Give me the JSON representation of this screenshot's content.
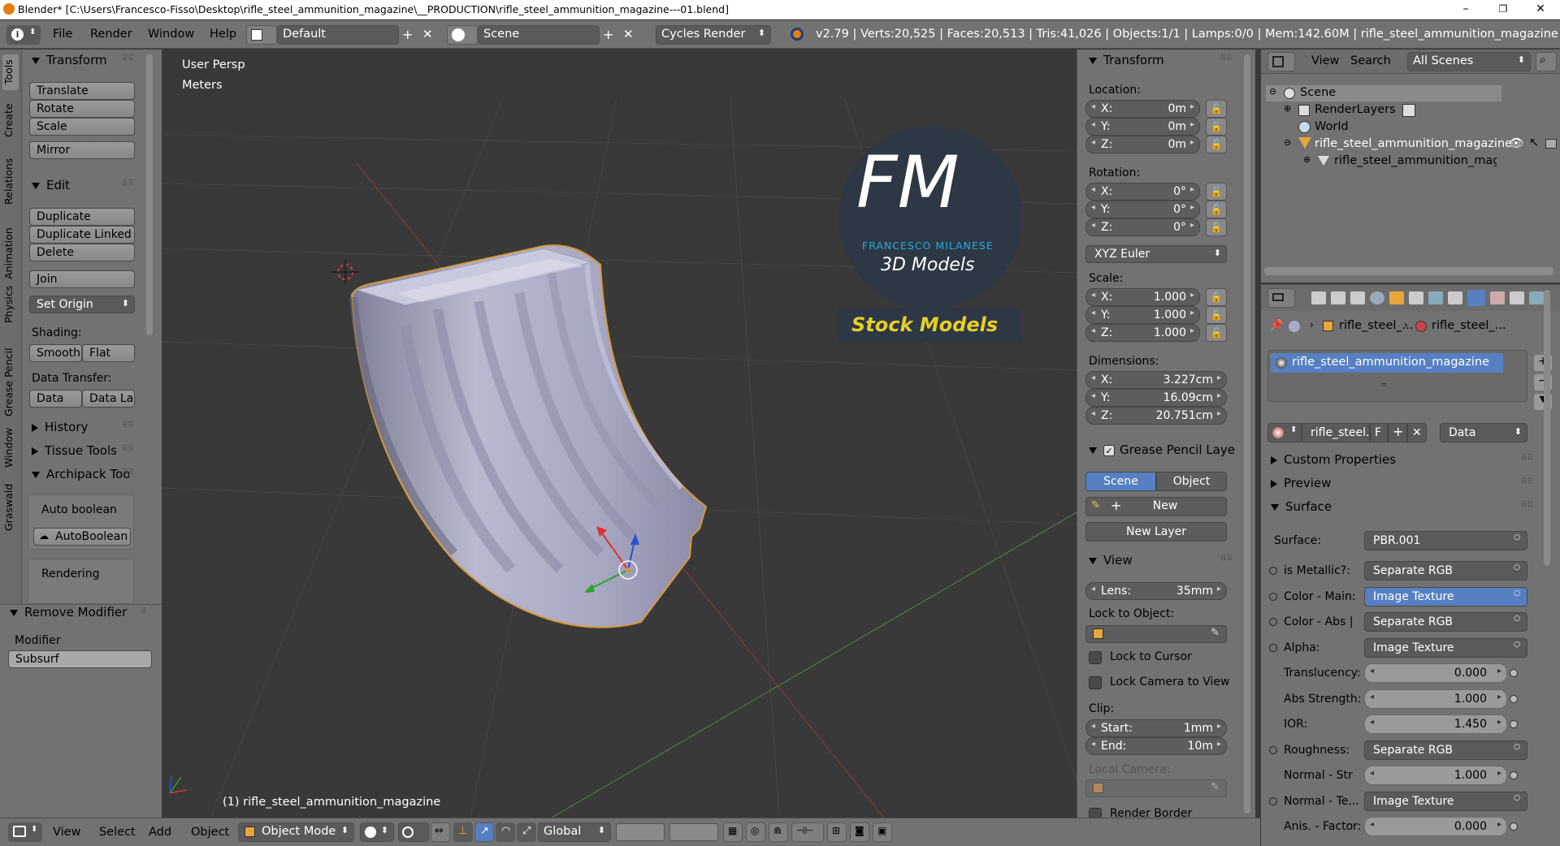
{
  "titlebar": {
    "title": "Blender* [C:\\Users\\Francesco-Fisso\\Desktop\\rifle_steel_ammunition_magazine\\__PRODUCTION\\rifle_steel_ammunition_magazine---01.blend]",
    "minimize": "–",
    "maximize": "❐",
    "close": "✕"
  },
  "header": {
    "menus": [
      "File",
      "Render",
      "Window",
      "Help"
    ],
    "layout": "Default",
    "scene": "Scene",
    "engine": "Cycles Render",
    "stats": "v2.79 | Verts:20,525 | Faces:20,513 | Tris:41,026 | Objects:1/1 | Lamps:0/0 | Mem:142.60M | rifle_steel_ammunition_magazine"
  },
  "tool_tabs": [
    "Tools",
    "Create",
    "Relations",
    "Animation",
    "Physics",
    "Grease Pencil",
    "Window",
    "Graswald"
  ],
  "toolshelf": {
    "transform": {
      "title": "Transform",
      "buttons": [
        "Translate",
        "Rotate",
        "Scale",
        "Mirror"
      ]
    },
    "edit": {
      "title": "Edit",
      "buttons": [
        "Duplicate",
        "Duplicate Linked",
        "Delete",
        "Join"
      ],
      "set_origin": "Set Origin",
      "shading_label": "Shading:",
      "smooth": "Smooth",
      "flat": "Flat",
      "data_transfer_label": "Data Transfer:",
      "data": "Data",
      "data_la": "Data La"
    },
    "history": "History",
    "tissue": "Tissue Tools",
    "archipack": {
      "title": "Archipack Tools",
      "auto_boolean": "Auto boolean",
      "autoboolean_btn": "AutoBoolean",
      "rendering": "Rendering"
    }
  },
  "operator_panel": {
    "title": "Remove Modifier",
    "modifier_label": "Modifier",
    "modifier_value": "Subsurf"
  },
  "viewport": {
    "view_name": "User Persp",
    "units": "Meters",
    "object_label": "(1) rifle_steel_ammunition_magazine",
    "logo": {
      "letters": "FM",
      "name": "FRANCESCO MILANESE",
      "subtitle": "3D Models",
      "badge": "Stock Models"
    }
  },
  "npanel": {
    "transform_title": "Transform",
    "location_label": "Location:",
    "location": [
      {
        "k": "X:",
        "v": "0m"
      },
      {
        "k": "Y:",
        "v": "0m"
      },
      {
        "k": "Z:",
        "v": "0m"
      }
    ],
    "rotation_label": "Rotation:",
    "rotation": [
      {
        "k": "X:",
        "v": "0°"
      },
      {
        "k": "Y:",
        "v": "0°"
      },
      {
        "k": "Z:",
        "v": "0°"
      }
    ],
    "rotation_mode": "XYZ Euler",
    "scale_label": "Scale:",
    "scale": [
      {
        "k": "X:",
        "v": "1.000"
      },
      {
        "k": "Y:",
        "v": "1.000"
      },
      {
        "k": "Z:",
        "v": "1.000"
      }
    ],
    "dimensions_label": "Dimensions:",
    "dimensions": [
      {
        "k": "X:",
        "v": "3.227cm"
      },
      {
        "k": "Y:",
        "v": "16.09cm"
      },
      {
        "k": "Z:",
        "v": "20.751cm"
      }
    ],
    "gp_title": "Grease Pencil Layer",
    "gp_scene": "Scene",
    "gp_object": "Object",
    "gp_new": "New",
    "gp_new_layer": "New Layer",
    "view_title": "View",
    "lens_label": "Lens:",
    "lens_value": "35mm",
    "lock_to_object": "Lock to Object:",
    "lock_to_cursor": "Lock to Cursor",
    "lock_camera": "Lock Camera to View",
    "clip_label": "Clip:",
    "clip_start_label": "Start:",
    "clip_start": "1mm",
    "clip_end_label": "End:",
    "clip_end": "10m",
    "local_camera": "Local Camera:",
    "render_border": "Render Border"
  },
  "outliner": {
    "view": "View",
    "search": "Search",
    "all_scenes": "All Scenes",
    "items": [
      "Scene",
      "RenderLayers",
      "World",
      "rifle_steel_ammunition_magazine",
      "rifle_steel_ammunition_magaz"
    ]
  },
  "properties": {
    "breadcrumb_a": "rifle_steel_...",
    "breadcrumb_b": "rifle_steel_...",
    "material_slot": "rifle_steel_ammunition_magazine",
    "material_name": "rifle_steel...",
    "fake_user": "F",
    "link": "Data",
    "sections": [
      "Custom Properties",
      "Preview",
      "Surface"
    ],
    "surface_label": "Surface:",
    "surface_value": "PBR.001",
    "inputs": [
      {
        "label": "is Metallic?:",
        "value": "Separate RGB",
        "kind": "link",
        "dot": true
      },
      {
        "label": "Color - Main:",
        "value": "Image Texture",
        "kind": "link",
        "dot": true,
        "hl": true
      },
      {
        "label": "Color - Abs |",
        "value": "Separate RGB",
        "kind": "link",
        "dot": true
      },
      {
        "label": "Alpha:",
        "value": "Image Texture",
        "kind": "link",
        "dot": true
      },
      {
        "label": "Translucency:",
        "value": "0.000",
        "kind": "num"
      },
      {
        "label": "Abs Strength:",
        "value": "1.000",
        "kind": "num"
      },
      {
        "label": "IOR:",
        "value": "1.450",
        "kind": "num"
      },
      {
        "label": "Roughness:",
        "value": "Separate RGB",
        "kind": "link",
        "dot": true
      },
      {
        "label": "Normal - Str",
        "value": "1.000",
        "kind": "num"
      },
      {
        "label": "Normal - Te...",
        "value": "Image Texture",
        "kind": "link",
        "dot": true
      },
      {
        "label": "Anis. - Factor:",
        "value": "0.000",
        "kind": "num"
      }
    ]
  },
  "bottombar": {
    "menus": [
      "View",
      "Select",
      "Add",
      "Object"
    ],
    "mode": "Object Mode",
    "orientation": "Global"
  }
}
